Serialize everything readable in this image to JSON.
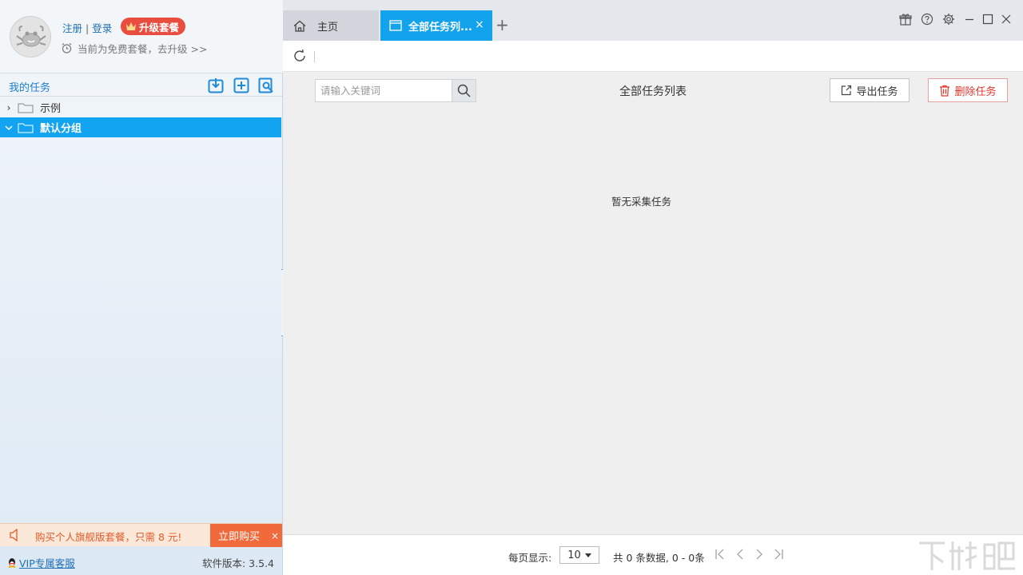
{
  "user": {
    "register_label": "注册",
    "separator": "|",
    "login_label": "登录",
    "upgrade_label": "升级套餐",
    "plan_text": "当前为免费套餐，去升级 >>"
  },
  "sidebar": {
    "title": "我的任务",
    "toolbar_icons": [
      "import-icon",
      "add-icon",
      "search-task-icon"
    ],
    "groups": [
      {
        "label": "示例",
        "expanded": false,
        "selected": false
      },
      {
        "label": "默认分组",
        "expanded": true,
        "selected": true
      }
    ],
    "promo": {
      "text": "购买个人旗舰版套餐，只需 8 元!",
      "buy_label": "立即购买",
      "close_label": "×"
    },
    "footer": {
      "vip_label": "VIP专属客服",
      "version_text": "软件版本: 3.5.4"
    }
  },
  "tabs": [
    {
      "label": "主页",
      "icon": "home-icon",
      "active": false
    },
    {
      "label": "全部任务列...",
      "icon": "window-icon",
      "active": true,
      "close_label": "×"
    }
  ],
  "tab_add_label": "+",
  "window_controls": [
    "gift-icon",
    "help-icon",
    "settings-icon",
    "minimize-icon",
    "maximize-icon",
    "close-icon"
  ],
  "task_list": {
    "search_placeholder": "请输入关键词",
    "title": "全部任务列表",
    "export_label": "导出任务",
    "delete_label": "删除任务",
    "empty_text": "暂无采集任务"
  },
  "pagination": {
    "per_page_label": "每页显示:",
    "per_page_value": "10",
    "total_text": "共 0 条数据, 0 - 0条"
  },
  "colors": {
    "accent": "#13a3ec",
    "upgrade": "#e94d3f",
    "promo": "#f06a3b",
    "delete": "#e2342b",
    "link": "#1e6fb5"
  }
}
